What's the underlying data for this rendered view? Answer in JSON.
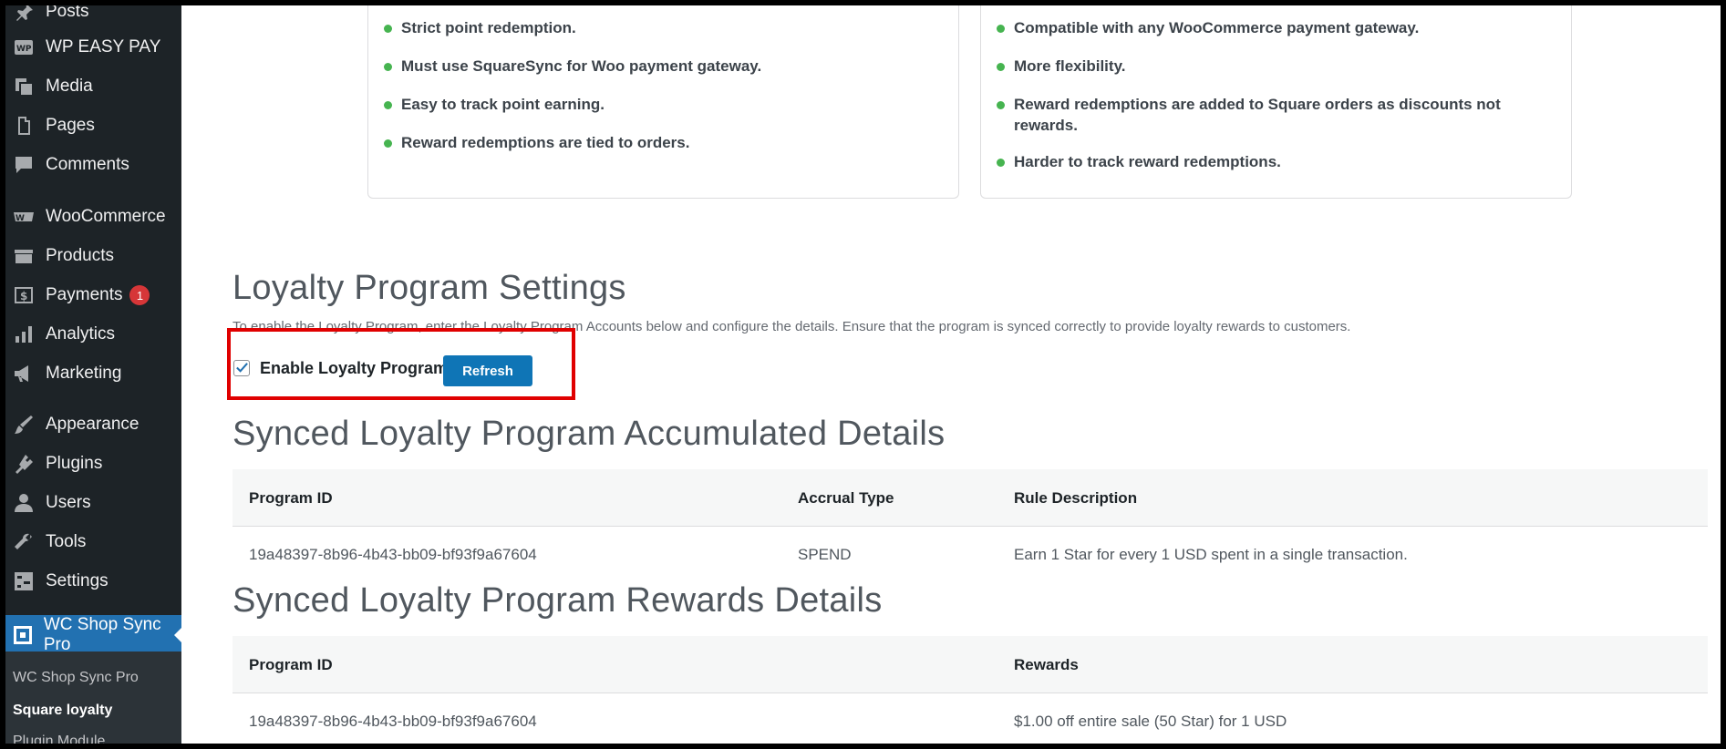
{
  "sidebar": {
    "items": [
      {
        "label": "Posts",
        "icon": "pin-icon"
      },
      {
        "label": "WP EASY PAY",
        "icon": "wp-easy-pay-icon"
      },
      {
        "label": "Media",
        "icon": "media-icon"
      },
      {
        "label": "Pages",
        "icon": "pages-icon"
      },
      {
        "label": "Comments",
        "icon": "comments-icon"
      },
      {
        "label": "WooCommerce",
        "icon": "woocommerce-icon"
      },
      {
        "label": "Products",
        "icon": "products-icon"
      },
      {
        "label": "Payments",
        "icon": "payments-icon",
        "badge": "1"
      },
      {
        "label": "Analytics",
        "icon": "analytics-icon"
      },
      {
        "label": "Marketing",
        "icon": "megaphone-icon"
      },
      {
        "label": "Appearance",
        "icon": "brush-icon"
      },
      {
        "label": "Plugins",
        "icon": "plugin-icon"
      },
      {
        "label": "Users",
        "icon": "users-icon"
      },
      {
        "label": "Tools",
        "icon": "wrench-icon"
      },
      {
        "label": "Settings",
        "icon": "settings-icon"
      },
      {
        "label": "WC Shop Sync Pro",
        "icon": "square-icon"
      }
    ],
    "submenu": [
      "WC Shop Sync Pro",
      "Square loyalty",
      "Plugin Module"
    ]
  },
  "cards": {
    "left": [
      "Strict point redemption.",
      "Must use SquareSync for Woo payment gateway.",
      "Easy to track point earning.",
      "Reward redemptions are tied to orders."
    ],
    "right": [
      "Compatible with any WooCommerce payment gateway.",
      "More flexibility.",
      "Reward redemptions are added to Square orders as discounts not rewards.",
      "Harder to track reward redemptions."
    ]
  },
  "settings": {
    "title": "Loyalty Program Settings",
    "description": "To enable the Loyalty Program, enter the Loyalty Program Accounts below and configure the details. Ensure that the program is synced correctly to provide loyalty rewards to customers.",
    "enable_label": "Enable Loyalty Program",
    "enabled": true,
    "refresh_label": "Refresh"
  },
  "accumulated": {
    "title": "Synced Loyalty Program Accumulated Details",
    "headers": [
      "Program ID",
      "Accrual Type",
      "Rule Description"
    ],
    "row": [
      "19a48397-8b96-4b43-bb09-bf93f9a67604",
      "SPEND",
      "Earn 1 Star for every 1 USD spent in a single transaction."
    ]
  },
  "rewards": {
    "title": "Synced Loyalty Program Rewards Details",
    "headers": [
      "Program ID",
      "Rewards"
    ],
    "row": [
      "19a48397-8b96-4b43-bb09-bf93f9a67604",
      "$1.00 off entire sale (50 Star) for 1 USD"
    ]
  },
  "colors": {
    "sidebar_bg": "#1d2327",
    "active_bg": "#2271b1",
    "button_bg": "#0f75b6",
    "highlight": "#e00000",
    "bullet": "#46b450"
  }
}
